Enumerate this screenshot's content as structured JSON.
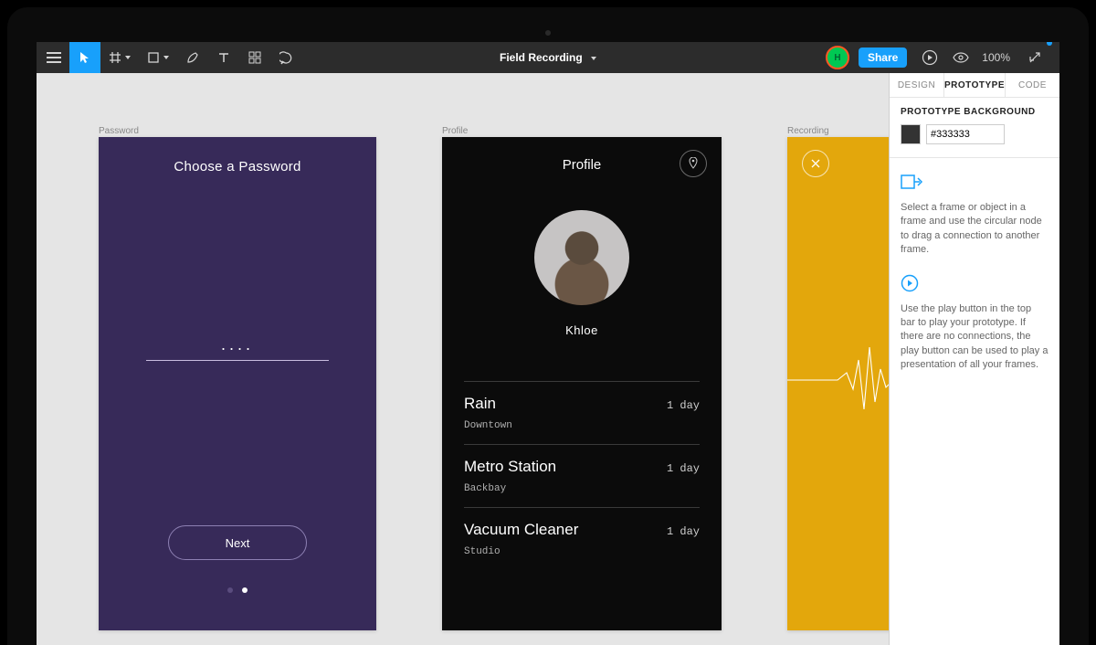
{
  "app": {
    "title": "Field Recording"
  },
  "toolbar": {
    "share_label": "Share",
    "zoom": "100%",
    "avatar_initial": "H"
  },
  "panel": {
    "tabs": {
      "design": "DESIGN",
      "prototype": "PROTOTYPE",
      "code": "CODE"
    },
    "bg_heading": "PROTOTYPE BACKGROUND",
    "bg_value": "333333",
    "bg_display": "#333333",
    "help1": "Select a frame or object in a frame and use the circular node to drag a connection to another frame.",
    "help2": "Use the play button in the top bar to play your prototype. If there are no connections, the play button can be used to play a presentation of all your frames."
  },
  "frames": {
    "password": {
      "label": "Password",
      "title": "Choose a Password",
      "masked": "....",
      "next": "Next"
    },
    "profile": {
      "label": "Profile",
      "title": "Profile",
      "name": "Khloe",
      "items": [
        {
          "title": "Rain",
          "sub": "Downtown",
          "ago": "1 day"
        },
        {
          "title": "Metro Station",
          "sub": "Backbay",
          "ago": "1 day"
        },
        {
          "title": "Vacuum Cleaner",
          "sub": "Studio",
          "ago": "1 day"
        }
      ]
    },
    "recording": {
      "label": "Recording"
    }
  }
}
